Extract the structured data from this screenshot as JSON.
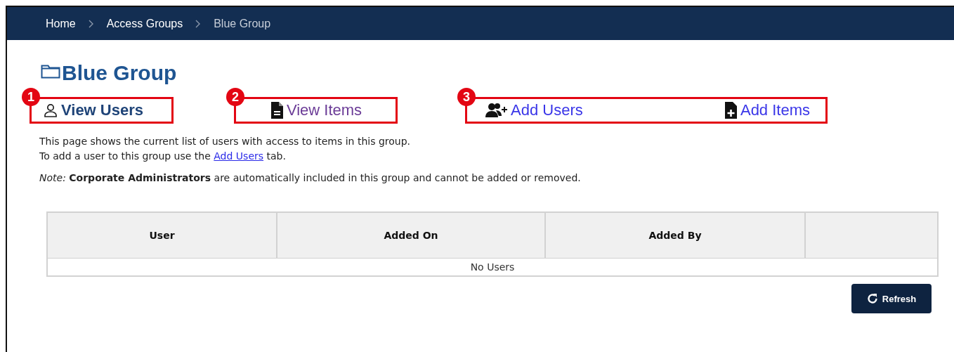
{
  "breadcrumb": [
    {
      "label": "Home",
      "current": false
    },
    {
      "label": "Access Groups",
      "current": false
    },
    {
      "label": "Blue Group",
      "current": true
    }
  ],
  "title": "Blue Group",
  "callouts": [
    {
      "number": "1",
      "tabs": [
        {
          "label": "View Users",
          "selected": true,
          "visited": false,
          "kind": "user"
        }
      ]
    },
    {
      "number": "2",
      "tabs": [
        {
          "label": "View Items",
          "selected": false,
          "visited": true,
          "kind": "file"
        }
      ]
    },
    {
      "number": "3",
      "tabs": [
        {
          "label": "Add Users",
          "selected": false,
          "visited": false,
          "kind": "useradd"
        },
        {
          "label": "Add Items",
          "selected": false,
          "visited": false,
          "kind": "fileadd"
        }
      ]
    }
  ],
  "intro": [
    {
      "text": "This page shows the current list of users with access to items in this group."
    },
    {
      "text": "To add a user to this group use the ",
      "link": "Add Users",
      "after": " tab."
    }
  ],
  "note": "*Note:* **Corporate Administrators** are automatically included in this group and cannot be added or removed.",
  "table": {
    "columns": [
      "User",
      "Added On",
      "Added By"
    ],
    "empty_text": "No Users"
  },
  "refresh_button": "Refresh"
}
